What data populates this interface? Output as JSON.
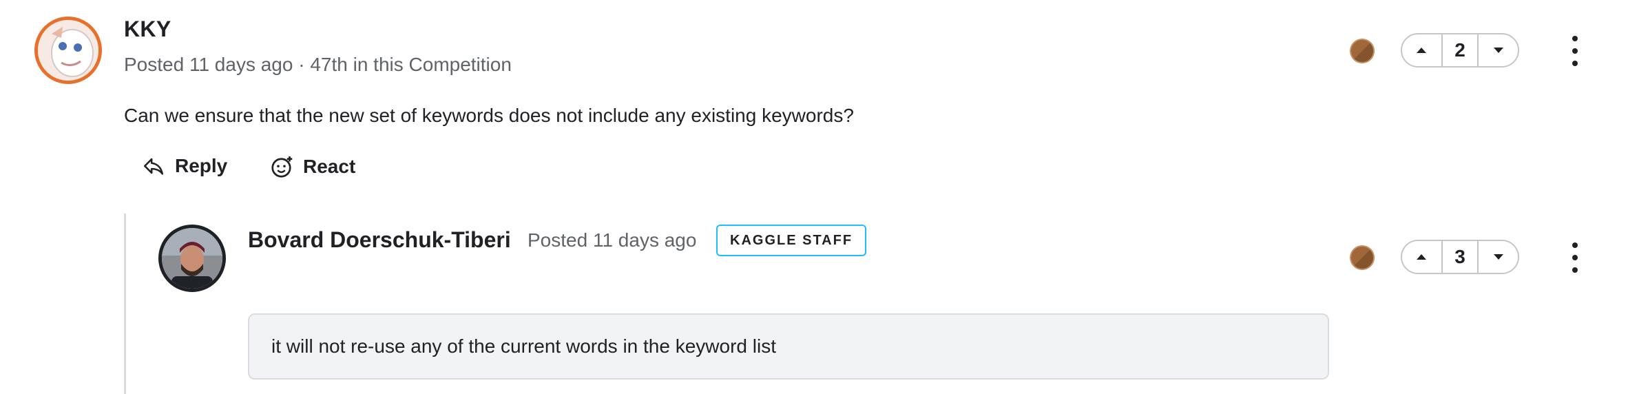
{
  "comment": {
    "username": "KKY",
    "meta": "Posted 11 days ago · 47th in this Competition",
    "body": "Can we ensure that the new set of keywords does not include any existing keywords?",
    "actions": {
      "reply_label": "Reply",
      "react_label": "React"
    },
    "votes": 2
  },
  "reply": {
    "username": "Bovard Doerschuk-Tiberi",
    "meta": "Posted 11 days ago",
    "badge": "KAGGLE STAFF",
    "body": "it will not re-use any of the current words in the keyword list",
    "votes": 3
  },
  "icons": {
    "medal": "bronze-medal-icon",
    "upvote": "caret-up-icon",
    "downvote": "caret-down-icon",
    "more": "more-vert-icon",
    "reply": "reply-arrow-icon",
    "react": "add-reaction-icon"
  },
  "colors": {
    "avatar_ring": "#e8702a",
    "staff_badge_border": "#20beff",
    "medal_bronze": "#a0683a"
  }
}
